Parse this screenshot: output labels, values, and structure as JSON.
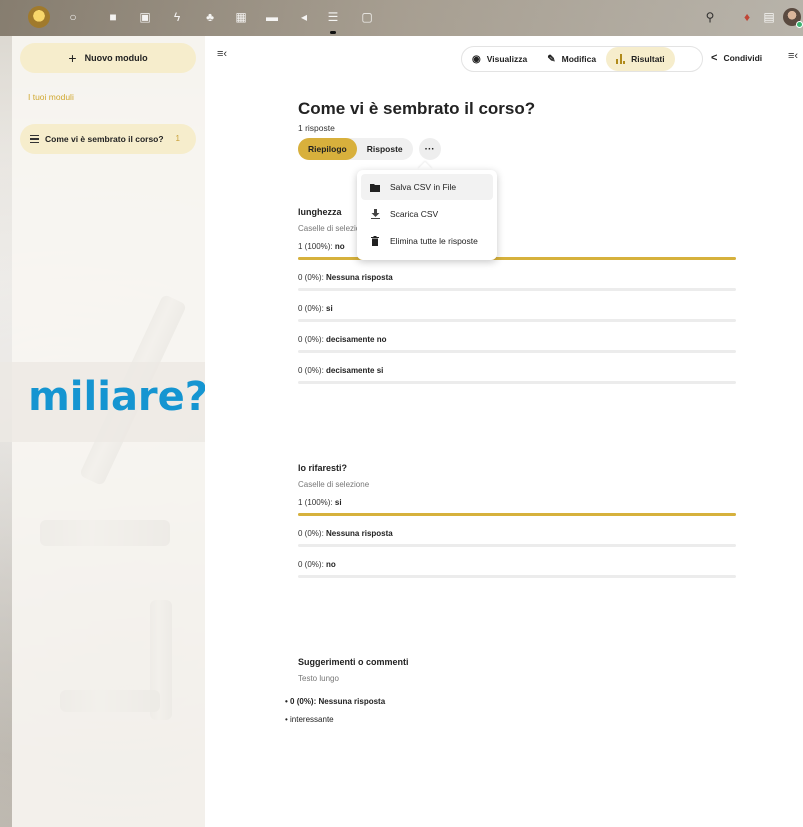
{
  "topbar": {
    "apps": [
      "circle-icon",
      "folder-icon",
      "image-icon",
      "activity-icon",
      "contacts-icon",
      "calendar-icon",
      "deck-icon",
      "announcements-icon",
      "forms-icon",
      "photos-icon"
    ],
    "right_icons": [
      "search-icon",
      "notifications-icon",
      "contacts-menu-icon"
    ]
  },
  "sidebar": {
    "new_form_label": "Nuovo modulo",
    "section_label": "I tuoi moduli",
    "forms": [
      {
        "label": "Come vi è sembrato il corso?",
        "count": "1"
      }
    ]
  },
  "background_text": "miliare?",
  "header": {
    "view_label": "Visualizza",
    "edit_label": "Modifica",
    "results_label": "Risultati",
    "share_label": "Condividi"
  },
  "form": {
    "title": "Come vi è sembrato il corso?",
    "responses_count": "1 risposte",
    "tabs": {
      "summary": "Riepilogo",
      "responses": "Risposte"
    },
    "more_label": "···"
  },
  "menu": {
    "items": [
      {
        "label": "Salva CSV in File",
        "icon": "folder-icon"
      },
      {
        "label": "Scarica CSV",
        "icon": "download-icon"
      },
      {
        "label": "Elimina tutte le risposte",
        "icon": "trash-icon"
      }
    ]
  },
  "questions": [
    {
      "title": "lunghezza",
      "type": "Caselle di selezione",
      "answers": [
        {
          "count": "1 (100%):",
          "label": "no",
          "fraction": 1.0
        },
        {
          "count": "0 (0%):",
          "label": "Nessuna risposta",
          "fraction": 0
        },
        {
          "count": "0 (0%):",
          "label": "si",
          "fraction": 0
        },
        {
          "count": "0 (0%):",
          "label": "decisamente no",
          "fraction": 0
        },
        {
          "count": "0 (0%):",
          "label": "decisamente si",
          "fraction": 0
        }
      ]
    },
    {
      "title": "lo rifaresti?",
      "type": "Caselle di selezione",
      "answers": [
        {
          "count": "1 (100%):",
          "label": "si",
          "fraction": 1.0
        },
        {
          "count": "0 (0%):",
          "label": "Nessuna risposta",
          "fraction": 0
        },
        {
          "count": "0 (0%):",
          "label": "no",
          "fraction": 0
        }
      ]
    }
  ],
  "comments": {
    "title": "Suggerimenti o commenti",
    "type": "Testo lungo",
    "items": [
      "0 (0%): Nessuna risposta",
      "interessante"
    ]
  },
  "colors": {
    "accent": "#d6b13c",
    "accent_light": "#f6edcc",
    "brand_blue": "#1595d1"
  }
}
